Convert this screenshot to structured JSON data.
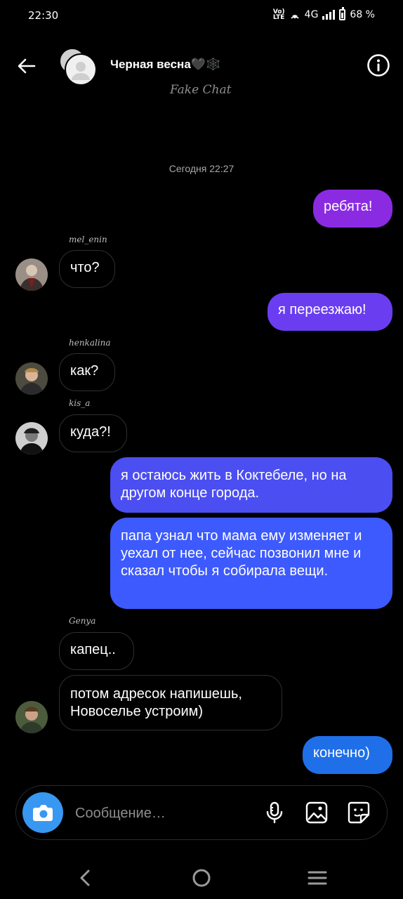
{
  "status": {
    "time": "22:30",
    "volte": "Vo)",
    "lte": "LTE",
    "network": "4G",
    "battery": "68 %"
  },
  "header": {
    "title": "Черная весна🖤🕸️",
    "watermark": "Fake Chat",
    "icons": {
      "back": "back-arrow-icon",
      "info": "info-icon"
    }
  },
  "chat": {
    "date": "Сегодня 22:27",
    "messages": [
      {
        "text": "ребята!",
        "from": "me"
      },
      {
        "sender": "mel_enin",
        "text": "что?"
      },
      {
        "text": "я переезжаю!",
        "from": "me"
      },
      {
        "sender": "henkalina",
        "text": "как?"
      },
      {
        "sender": "kis_a",
        "text": "куда?!"
      },
      {
        "text": "я остаюсь жить в Коктебеле, но на другом конце города.",
        "from": "me"
      },
      {
        "text": "папа узнал что мама ему изменяет и уехал от нее, сейчас позвонил мне и сказал чтобы я собирала вещи.",
        "from": "me"
      },
      {
        "sender": "Genya",
        "text": "капец.."
      },
      {
        "text": "потом адресок напишешь, Новоселье устроим)",
        "from": "Genya"
      },
      {
        "text": "конечно)",
        "from": "me"
      }
    ]
  },
  "composer": {
    "placeholder": "Сообщение…",
    "icons": [
      "camera-icon",
      "microphone-icon",
      "gallery-icon",
      "sticker-icon"
    ]
  },
  "colors": {
    "purple": "#8a2be2",
    "violet": "#6a3df0",
    "blue": "#3d5afe",
    "camera": "#3897f0",
    "background": "#000000"
  }
}
